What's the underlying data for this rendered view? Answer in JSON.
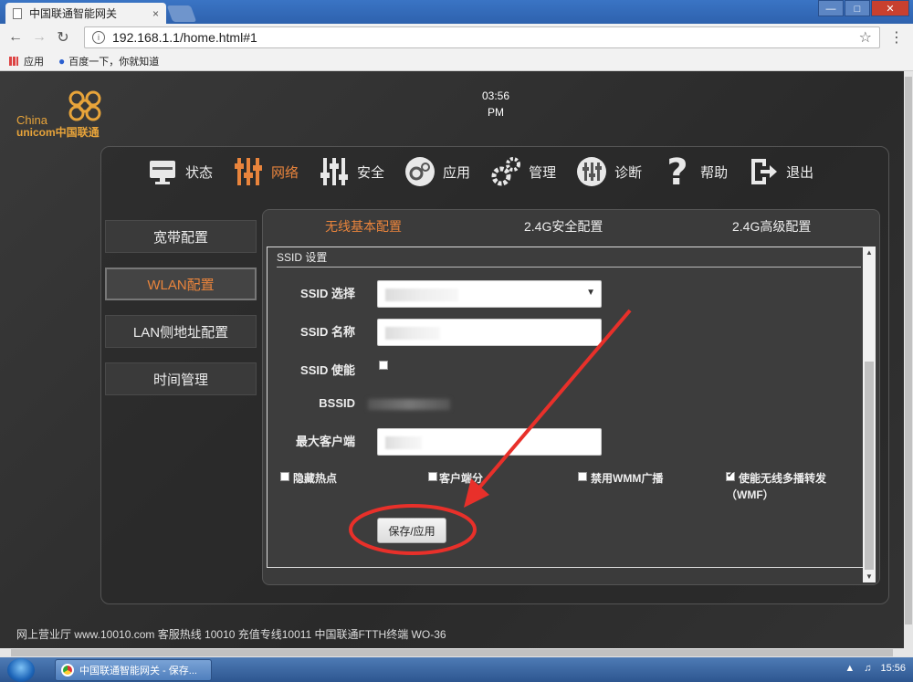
{
  "browser": {
    "tab_title": "中国联通智能网关",
    "tab_close": "×",
    "url": "192.168.1.1/home.html#1",
    "bookmarks": [
      "应用",
      "百度一下，你就知道"
    ]
  },
  "header": {
    "logo_en": "China",
    "logo_unicom": "unicom中国联通",
    "time": "03:56",
    "ampm": "PM"
  },
  "topnav": [
    {
      "label": "状态",
      "icon": "monitor-icon"
    },
    {
      "label": "网络",
      "icon": "network-sliders-icon",
      "active": true
    },
    {
      "label": "安全",
      "icon": "security-sliders-icon"
    },
    {
      "label": "应用",
      "icon": "gear-circle-icon"
    },
    {
      "label": "管理",
      "icon": "gears-icon"
    },
    {
      "label": "诊断",
      "icon": "diagnose-icon"
    },
    {
      "label": "帮助",
      "icon": "question-icon"
    },
    {
      "label": "退出",
      "icon": "logout-icon"
    }
  ],
  "sidebar": [
    {
      "label": "宽带配置"
    },
    {
      "label": "WLAN配置",
      "active": true
    },
    {
      "label": "LAN侧地址配置"
    },
    {
      "label": "时间管理"
    }
  ],
  "subtabs": [
    "无线基本配置",
    "2.4G安全配置",
    "2.4G高级配置"
  ],
  "form": {
    "section_title": "SSID 设置",
    "ssid_select_label": "SSID 选择",
    "ssid_name_label": "SSID 名称",
    "ssid_enable_label": "SSID 使能",
    "bssid_label": "BSSID",
    "max_clients_label": "最大客户端",
    "options": [
      {
        "label": "隐藏热点",
        "checked": false
      },
      {
        "label": "客户端分",
        "checked": false
      },
      {
        "label": "禁用WMM广播",
        "checked": false
      },
      {
        "label": "使能无线多播转发",
        "checked": true
      },
      {
        "label": "（WMF）"
      }
    ],
    "save_label": "保存/应用"
  },
  "footer": "网上营业厅 www.10010.com 客服热线 10010 充值专线10011 中国联通FTTH终端 WO-36",
  "taskbar": {
    "task_title": "中国联通智能网关 - 保存...",
    "clock": "15:56"
  },
  "colors": {
    "accent": "#e9843c",
    "annotation": "#e8302a",
    "logo": "#e8a43a"
  }
}
